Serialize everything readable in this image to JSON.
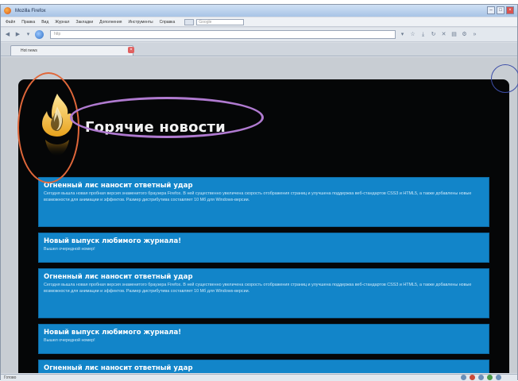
{
  "window": {
    "title": "Mozilla Firefox"
  },
  "menu": {
    "items": [
      "Файл",
      "Правка",
      "Вид",
      "Журнал",
      "Закладки",
      "Дополнения",
      "Инструменты",
      "Справка"
    ],
    "search_placeholder": "Google"
  },
  "nav": {
    "back_icon": "back-arrow-icon",
    "forward_icon": "forward-arrow-icon",
    "url": "http"
  },
  "tab": {
    "label": "Hot news"
  },
  "page": {
    "title": "Горячие новости",
    "news": [
      {
        "title": "Огненный лис наносит ответный удар",
        "text": "Сегодня вышла новая пробная версия знаменитого браузера Firefox. В ней существенно увеличена скорость отображения страниц и улучшена поддержка веб-стандартов CSS3 и HTML5, а также добавлены новые возможности для анимации и эффектов. Размер дистрибутива составляет 10 Мб для Windows-версии."
      },
      {
        "title": "Новый выпуск любимого журнала!",
        "text": "Вышел очередной номер!"
      },
      {
        "title": "Огненный лис наносит ответный удар",
        "text": "Сегодня вышла новая пробная версия знаменитого браузера Firefox. В ней существенно увеличена скорость отображения страниц и улучшена поддержка веб-стандартов CSS3 и HTML5, а также добавлены новые возможности для анимации и эффектов. Размер дистрибутива составляет 10 Мб для Windows-версии."
      },
      {
        "title": "Новый выпуск любимого журнала!",
        "text": "Вышел очередной номер!"
      },
      {
        "title": "Огненный лис наносит ответный удар",
        "text": ""
      }
    ]
  },
  "status": {
    "text": "Готово"
  },
  "colors": {
    "page_background": "#050607",
    "news_block": "#1285c9",
    "ring_logo": "#e0673a",
    "ring_title": "#b07ad0",
    "ring_corner": "#3d4ea8"
  }
}
